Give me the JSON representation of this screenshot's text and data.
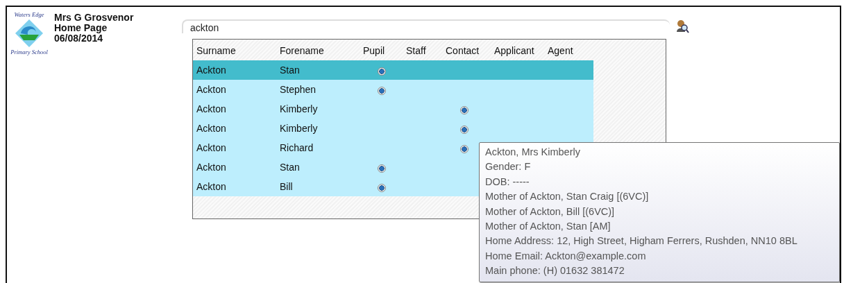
{
  "logo": {
    "top_text": "Waters Edge",
    "bottom_text": "Primary School"
  },
  "header": {
    "user": "Mrs G Grosvenor",
    "page": "Home Page",
    "date": "06/08/2014"
  },
  "search": {
    "value": "ackton"
  },
  "table": {
    "columns": [
      {
        "label": "Surname",
        "kind": "text"
      },
      {
        "label": "Forename",
        "kind": "text"
      },
      {
        "label": "Pupil",
        "kind": "pupil"
      },
      {
        "label": "Staff",
        "kind": "staff"
      },
      {
        "label": "Contact",
        "kind": "contact"
      },
      {
        "label": "Applicant",
        "kind": "applicant"
      },
      {
        "label": "Agent",
        "kind": "agent"
      }
    ],
    "rows": [
      {
        "surname": "Ackton",
        "forename": "Stan",
        "pupil": true,
        "staff": false,
        "contact": false,
        "applicant": false,
        "agent": false,
        "selected": true
      },
      {
        "surname": "Ackton",
        "forename": "Stephen",
        "pupil": true,
        "staff": false,
        "contact": false,
        "applicant": false,
        "agent": false,
        "selected": false
      },
      {
        "surname": "Ackton",
        "forename": "Kimberly",
        "pupil": false,
        "staff": false,
        "contact": true,
        "applicant": false,
        "agent": false,
        "selected": false
      },
      {
        "surname": "Ackton",
        "forename": "Kimberly",
        "pupil": false,
        "staff": false,
        "contact": true,
        "applicant": false,
        "agent": false,
        "selected": false
      },
      {
        "surname": "Ackton",
        "forename": "Richard",
        "pupil": false,
        "staff": false,
        "contact": true,
        "applicant": false,
        "agent": false,
        "selected": false
      },
      {
        "surname": "Ackton",
        "forename": "Stan",
        "pupil": true,
        "staff": false,
        "contact": false,
        "applicant": false,
        "agent": false,
        "selected": false
      },
      {
        "surname": "Ackton",
        "forename": "Bill",
        "pupil": true,
        "staff": false,
        "contact": false,
        "applicant": false,
        "agent": false,
        "selected": false
      }
    ]
  },
  "tooltip": {
    "lines": [
      "Ackton, Mrs Kimberly",
      "Gender: F",
      "DOB: -----",
      "Mother of Ackton, Stan Craig [(6VC)]",
      "Mother of Ackton, Bill [(6VC)]",
      "Mother of Ackton, Stan [AM]",
      "Home Address: 12, High Street, Higham Ferrers, Rushden, NN10 8BL",
      "Home Email: Ackton@example.com",
      "Main phone: (H) 01632 381472"
    ]
  }
}
